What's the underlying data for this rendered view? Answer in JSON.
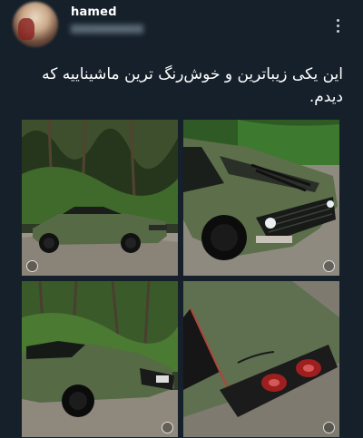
{
  "post": {
    "username": "hamed",
    "text": "این یکی زیباترین و خوش‌رنگ ترین ماشیناییه که دیدم.",
    "menu_icon": "more-vertical-icon"
  },
  "images": [
    {
      "alt": "green-car-side-view"
    },
    {
      "alt": "green-car-front-closeup"
    },
    {
      "alt": "green-car-rear-view"
    },
    {
      "alt": "green-car-taillight-closeup"
    }
  ],
  "colors": {
    "background": "#15202b",
    "car_green": "#5c6e4a",
    "text": "#ffffff"
  }
}
